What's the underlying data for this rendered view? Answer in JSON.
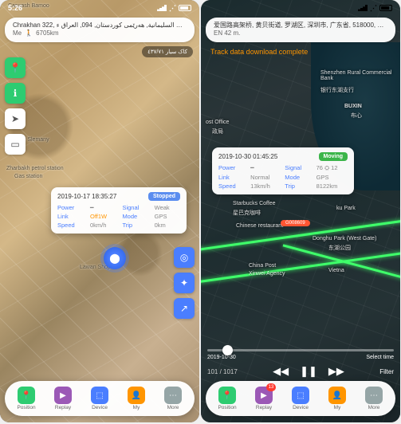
{
  "left": {
    "status_time": "5:26",
    "addr_line1": "Chrakhan 322, السليمانية, هەرێمی کوردستان, 094, العراق ء WS 6 m.",
    "addr_me": "Me ",
    "addr_dist": "6705km",
    "kak_label": "کاک سیار ٤٣٧/٧١",
    "card": {
      "time": "2019-10-17 18:35:27",
      "status": "Stopped",
      "power_l": "Power",
      "power_v": "━",
      "signal_l": "Signal",
      "signal_v": "Weak",
      "link_l": "Link",
      "link_v": "Off1W",
      "mode_l": "Mode",
      "mode_v": "GPS",
      "speed_l": "Speed",
      "speed_v": "0km/h",
      "trip_l": "Trip",
      "trip_v": "0km"
    },
    "pois": {
      "p1": "Carwash Bamoo",
      "p2": "Kery Slemany",
      "p3": "Zharbakh petrol station",
      "p4": "Gas station",
      "p5": "Lawan Shop"
    },
    "nav": {
      "position": "Position",
      "replay": "Replay",
      "device": "Device",
      "my": "My",
      "more": "More"
    }
  },
  "right": {
    "addr_line1": "爱国路高架桥, 黄贝街道, 罗湖区, 深圳市, 广东省, 518000, 中国 ء",
    "addr_line2": "EN 42 m.",
    "banner": "Track data download complete",
    "card": {
      "time": "2019-10-30 01:45:25",
      "status": "Moving",
      "power_l": "Power",
      "power_v": "━",
      "signal_l": "Signal",
      "signal_v": "76  ⛭ 12",
      "link_l": "Link",
      "link_v": "Normal",
      "mode_l": "Mode",
      "mode_v": "GPS",
      "speed_l": "Speed",
      "speed_v": "13km/h",
      "trip_l": "Trip",
      "trip_v": "8122km"
    },
    "pois": {
      "p1": "Shenzhen Rural Commercial Bank",
      "p2": "银行东湖支行",
      "p3": "BUXIN",
      "p4": "布心",
      "p5": "ost Office",
      "p6": "政局",
      "p7": "Starbucks Coffee",
      "p8": "星巴克咖啡",
      "p9": "ku Park",
      "p10": "Donghu Park (West Gate)",
      "p11": "China Post",
      "p12": "Xinwei Agency",
      "p13": "Chinese restaurant",
      "p14": "Vietna",
      "p15": "东湖公园"
    },
    "route": "G008609",
    "timeline": {
      "date": "2019-10-30",
      "select": "Select time",
      "count": "101 / 1017",
      "filter": "Filter"
    },
    "nav": {
      "position": "Position",
      "replay": "Replay",
      "device": "Device",
      "my": "My",
      "more": "More"
    },
    "badge": "13"
  }
}
